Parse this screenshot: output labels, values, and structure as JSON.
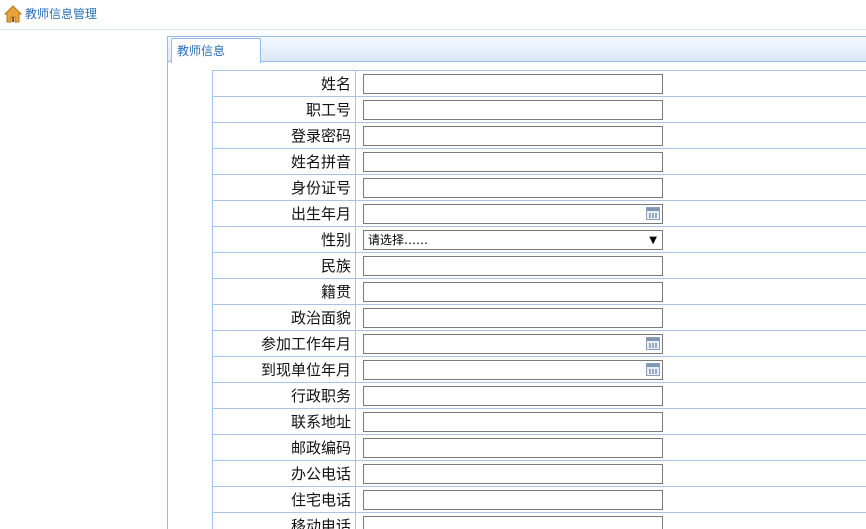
{
  "breadcrumb": {
    "label": "教师信息管理"
  },
  "tab": {
    "label": "教师信息"
  },
  "form": {
    "fields": [
      {
        "label": "姓名",
        "type": "text",
        "value": ""
      },
      {
        "label": "职工号",
        "type": "text",
        "value": ""
      },
      {
        "label": "登录密码",
        "type": "text",
        "value": ""
      },
      {
        "label": "姓名拼音",
        "type": "text",
        "value": ""
      },
      {
        "label": "身份证号",
        "type": "text",
        "value": ""
      },
      {
        "label": "出生年月",
        "type": "date",
        "value": ""
      },
      {
        "label": "性别",
        "type": "select",
        "value": "请选择……"
      },
      {
        "label": "民族",
        "type": "text",
        "value": ""
      },
      {
        "label": "籍贯",
        "type": "text",
        "value": ""
      },
      {
        "label": "政治面貌",
        "type": "text",
        "value": ""
      },
      {
        "label": "参加工作年月",
        "type": "date",
        "value": ""
      },
      {
        "label": "到现单位年月",
        "type": "date",
        "value": ""
      },
      {
        "label": "行政职务",
        "type": "text",
        "value": ""
      },
      {
        "label": "联系地址",
        "type": "text",
        "value": ""
      },
      {
        "label": "邮政编码",
        "type": "text",
        "value": ""
      },
      {
        "label": "办公电话",
        "type": "text",
        "value": ""
      },
      {
        "label": "住宅电话",
        "type": "text",
        "value": ""
      },
      {
        "label": "移动电话",
        "type": "text",
        "value": ""
      }
    ]
  },
  "icons": {
    "home": "home-icon",
    "calendar": "calendar-icon",
    "dropdown": "dropdown-arrow-icon"
  },
  "colors": {
    "link": "#2a6fb6",
    "border": "#a9c3e1",
    "home_icon": "#e8a33a"
  }
}
